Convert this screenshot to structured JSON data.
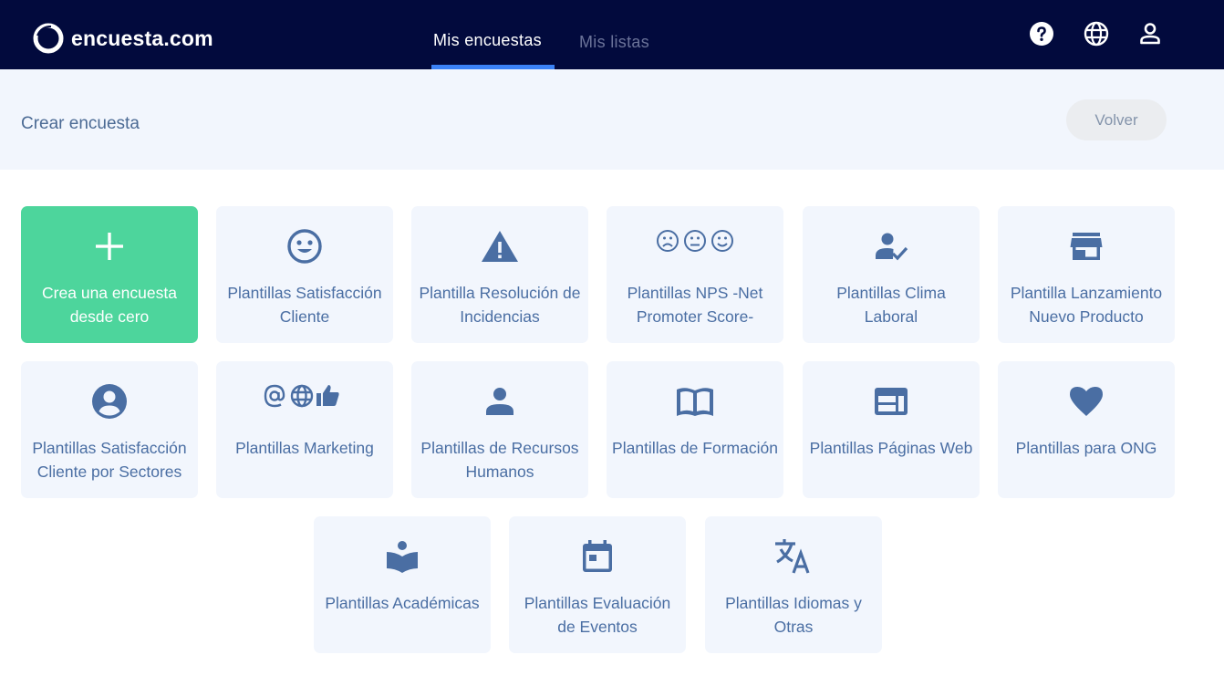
{
  "brand": {
    "name": "encuesta.com",
    "colors": {
      "navbar": "#020a3d",
      "accent": "#3b82f6",
      "primary_card": "#4dd59c",
      "card_bg": "#f2f6fd",
      "card_text": "#4a6ea3"
    }
  },
  "nav": {
    "tabs": [
      {
        "label": "Mis encuestas",
        "active": true
      },
      {
        "label": "Mis listas",
        "active": false
      }
    ],
    "icons": [
      "help-icon",
      "globe-icon",
      "user-icon"
    ]
  },
  "subheader": {
    "title": "Crear encuesta",
    "back_label": "Volver"
  },
  "cards": [
    {
      "label": "Crea una encuesta desde cero",
      "icon": "plus-icon"
    },
    {
      "label": "Plantillas Satisfacción Cliente",
      "icon": "smiley-icon"
    },
    {
      "label": "Plantilla Resolución de Incidencias",
      "icon": "warning-icon"
    },
    {
      "label": "Plantillas NPS -Net Promoter Score-",
      "icon": "faces-icon"
    },
    {
      "label": "Plantillas Clima Laboral",
      "icon": "user-check-icon"
    },
    {
      "label": "Plantilla Lanzamiento Nuevo Producto",
      "icon": "store-icon"
    },
    {
      "label": "Plantillas Satisfacción Cliente por Sectores",
      "icon": "account-circle-icon"
    },
    {
      "label": "Plantillas Marketing",
      "icon": "marketing-icons"
    },
    {
      "label": "Plantillas de Recursos Humanos",
      "icon": "person-icon"
    },
    {
      "label": "Plantillas de Formación",
      "icon": "book-icon"
    },
    {
      "label": "Plantillas Páginas Web",
      "icon": "web-icon"
    },
    {
      "label": "Plantillas para ONG",
      "icon": "heart-icon"
    },
    {
      "label": "Plantillas Académicas",
      "icon": "reader-icon"
    },
    {
      "label": "Plantillas Evaluación de Eventos",
      "icon": "calendar-icon"
    },
    {
      "label": "Plantillas Idiomas y Otras",
      "icon": "translate-icon"
    }
  ]
}
